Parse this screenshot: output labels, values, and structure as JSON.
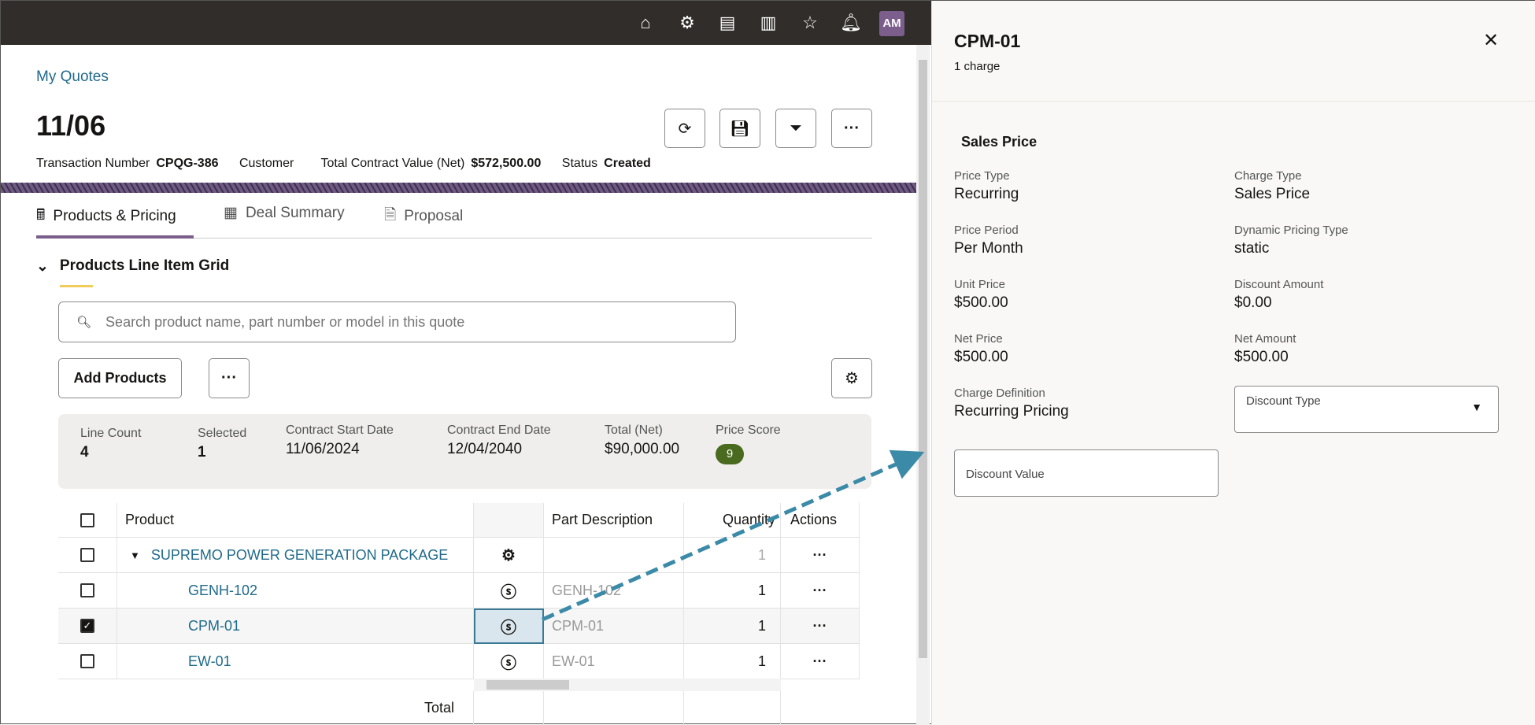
{
  "topbar": {
    "icons": [
      "home-icon",
      "gear-icon",
      "table-icon",
      "report-icon",
      "star-icon",
      "bell-icon"
    ],
    "avatar": "AM"
  },
  "breadcrumb": "My Quotes",
  "quote": {
    "title": "11/06",
    "meta": [
      {
        "label": "Transaction Number",
        "value": "CPQG-386"
      },
      {
        "label": "Customer",
        "value": ""
      },
      {
        "label": "Total Contract Value (Net)",
        "value": "$572,500.00"
      },
      {
        "label": "Status",
        "value": "Created"
      }
    ],
    "actions": [
      "refresh-icon",
      "save-icon",
      "funnel-icon",
      "more-icon"
    ]
  },
  "tabs": [
    {
      "label": "Products & Pricing",
      "icon": "calculator-icon",
      "active": true
    },
    {
      "label": "Deal Summary",
      "icon": "summary-icon"
    },
    {
      "label": "Proposal",
      "icon": "document-icon"
    }
  ],
  "section": {
    "title": "Products Line Item Grid"
  },
  "search": {
    "placeholder": "Search product name, part number or model in this quote",
    "value": ""
  },
  "toolbar": {
    "add_products": "Add Products",
    "more": "···"
  },
  "summary": [
    {
      "label": "Line Count",
      "value": "4"
    },
    {
      "label": "Selected",
      "value": "1"
    },
    {
      "label": "Contract Start Date",
      "value": "11/06/2024"
    },
    {
      "label": "Contract End Date",
      "value": "12/04/2040"
    },
    {
      "label": "Total (Net)",
      "value": "$90,000.00"
    },
    {
      "label": "Price Score",
      "value": "9"
    }
  ],
  "grid": {
    "headers": {
      "product": "Product",
      "part": "Part Description",
      "qty": "Quantity",
      "actions": "Actions"
    },
    "rows": [
      {
        "product": "SUPREMO POWER GENERATION PACKAGE",
        "icon": "configure-gear-icon",
        "part": "",
        "qty": "1",
        "checked": false,
        "parent": true
      },
      {
        "product": "GENH-102",
        "icon": "pricing-dollar-icon",
        "part": "GENH-102",
        "qty": "1",
        "checked": false
      },
      {
        "product": "CPM-01",
        "icon": "pricing-dollar-icon",
        "part": "CPM-01",
        "qty": "1",
        "checked": true
      },
      {
        "product": "EW-01",
        "icon": "pricing-dollar-icon",
        "part": "EW-01",
        "qty": "1",
        "checked": false
      }
    ],
    "total_label": "Total",
    "row_actions": "···"
  },
  "panel": {
    "title": "CPM-01",
    "subtitle": "1 charge",
    "section": "Sales Price",
    "fields": [
      {
        "label": "Price Type",
        "value": "Recurring"
      },
      {
        "label": "Charge Type",
        "value": "Sales Price"
      },
      {
        "label": "Price Period",
        "value": "Per Month"
      },
      {
        "label": "Dynamic Pricing Type",
        "value": "static"
      },
      {
        "label": "Unit Price",
        "value": "$500.00"
      },
      {
        "label": "Discount Amount",
        "value": "$0.00"
      },
      {
        "label": "Net Price",
        "value": "$500.00"
      },
      {
        "label": "Net Amount",
        "value": "$500.00"
      },
      {
        "label": "Charge Definition",
        "value": "Recurring Pricing"
      }
    ],
    "discount_type": {
      "label": "Discount Type",
      "value": ""
    },
    "discount_value": {
      "label": "Discount Value",
      "value": ""
    }
  },
  "colors": {
    "topbar": "#312d2a",
    "link": "#1f6a8a",
    "tab_active": "#7b5e8c",
    "price_score": "#4a6a1f",
    "arrow": "#3b8aa8"
  }
}
